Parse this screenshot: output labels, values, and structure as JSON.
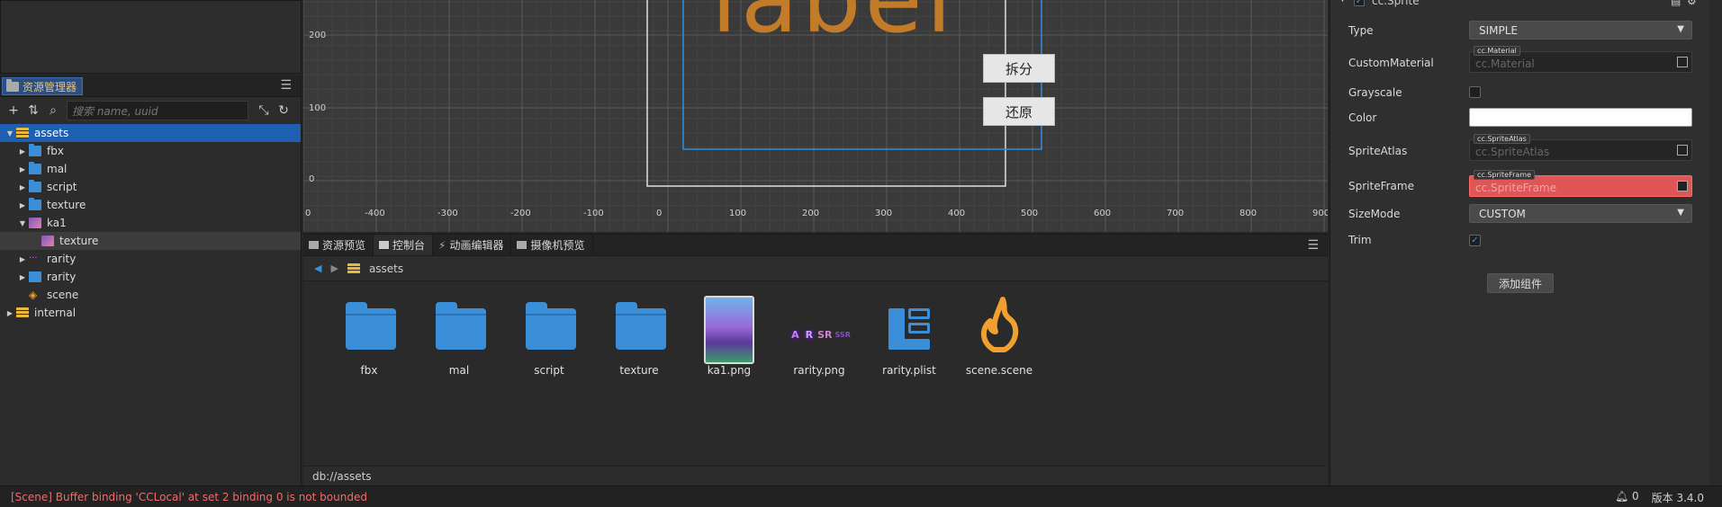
{
  "assets_panel": {
    "tab_label": "资源管理器",
    "search_placeholder": "搜索 name, uuid",
    "tree": [
      {
        "label": "assets",
        "depth": 0,
        "icon": "database-icon",
        "expanded": true,
        "selected": true
      },
      {
        "label": "fbx",
        "depth": 1,
        "icon": "folder-icon"
      },
      {
        "label": "mal",
        "depth": 1,
        "icon": "folder-icon"
      },
      {
        "label": "script",
        "depth": 1,
        "icon": "folder-icon"
      },
      {
        "label": "texture",
        "depth": 1,
        "icon": "folder-icon"
      },
      {
        "label": "ka1",
        "depth": 1,
        "icon": "image-icon",
        "expanded": true
      },
      {
        "label": "texture",
        "depth": 2,
        "icon": "texture-icon"
      },
      {
        "label": "rarity",
        "depth": 1,
        "icon": "sprite-atlas-icon"
      },
      {
        "label": "rarity",
        "depth": 1,
        "icon": "plist-icon"
      },
      {
        "label": "scene",
        "depth": 1,
        "icon": "scene-fire-icon"
      },
      {
        "label": "internal",
        "depth": 0,
        "icon": "database-icon"
      }
    ]
  },
  "scene": {
    "big_label": "label",
    "btn_split": "拆分",
    "btn_restore": "还原",
    "y_labels": [
      "200",
      "100",
      "0"
    ],
    "x_labels": [
      "0",
      "-400",
      "-300",
      "-200",
      "-100",
      "0",
      "100",
      "200",
      "300",
      "400",
      "500",
      "600",
      "700",
      "800",
      "900"
    ]
  },
  "bottom": {
    "tabs": [
      "资源预览",
      "控制台",
      "动画编辑器",
      "摄像机预览"
    ],
    "breadcrumb": "assets",
    "items": [
      {
        "name": "fbx",
        "kind": "folder"
      },
      {
        "name": "mal",
        "kind": "folder"
      },
      {
        "name": "script",
        "kind": "folder"
      },
      {
        "name": "texture",
        "kind": "folder"
      },
      {
        "name": "ka1.png",
        "kind": "image"
      },
      {
        "name": "rarity.png",
        "kind": "atlas"
      },
      {
        "name": "rarity.plist",
        "kind": "plist"
      },
      {
        "name": "scene.scene",
        "kind": "scene"
      }
    ],
    "path": "db://assets"
  },
  "inspector": {
    "component": "cc.Sprite",
    "type_label": "Type",
    "type_value": "SIMPLE",
    "custom_material_label": "CustomMaterial",
    "custom_material_tag": "cc.Material",
    "custom_material_placeholder": "cc.Material",
    "grayscale_label": "Grayscale",
    "color_label": "Color",
    "color_value": "#ffffff",
    "sprite_atlas_label": "SpriteAtlas",
    "sprite_atlas_tag": "cc.SpriteAtlas",
    "sprite_atlas_placeholder": "cc.SpriteAtlas",
    "sprite_frame_label": "SpriteFrame",
    "sprite_frame_tag": "cc.SpriteFrame",
    "sprite_frame_placeholder": "cc.SpriteFrame",
    "size_mode_label": "SizeMode",
    "size_mode_value": "CUSTOM",
    "trim_label": "Trim",
    "add_component": "添加组件"
  },
  "statusbar": {
    "error": "[Scene] Buffer binding 'CCLocal' at set 2 binding 0 is not bounded",
    "notifications": "0",
    "version": "版本 3.4.0"
  },
  "colors": {
    "accent": "#1f5fb2",
    "error": "#ef6c6c",
    "label_orange": "#c27b28"
  }
}
